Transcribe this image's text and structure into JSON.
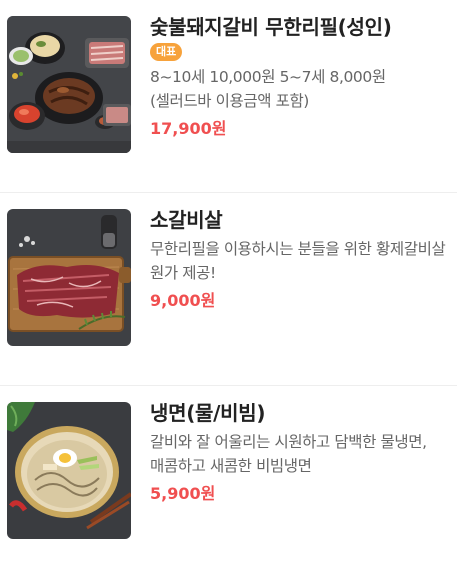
{
  "menu": [
    {
      "name": "숯불돼지갈비 무한리필(성인)",
      "badge": "대표",
      "description": "8~10세 10,000원 5~7세 8,000원 (셀러드바 이용금액 포함)",
      "price": "17,900원",
      "image": "pork-galbi-platter-image"
    },
    {
      "name": "소갈비살",
      "description": "무한리필을 이용하시는 분들을 위한 황제갈비살 원가 제공!",
      "price": "9,000원",
      "image": "beef-rib-meat-image"
    },
    {
      "name": "냉면(물/비빔)",
      "description": "갈비와 잘 어울리는 시원하고 담백한 물냉면, 매콤하고 새콤한 비빔냉면",
      "price": "5,900원",
      "image": "cold-noodles-image"
    }
  ],
  "colors": {
    "price": "#f04f50",
    "badge": "#f7a23b",
    "title": "#222222",
    "description": "#666666"
  }
}
